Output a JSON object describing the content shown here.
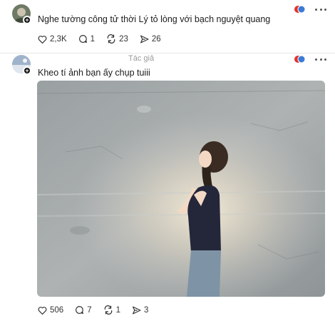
{
  "posts": [
    {
      "text": "Nghe tường công tử thời Lý tỏ lòng với bạch nguyệt quang",
      "likes": "2,3K",
      "comments": "1",
      "reposts": "23",
      "shares": "26"
    },
    {
      "author_tag": "Tác giả",
      "text": "Kheo tí ảnh bạn ấy chụp tuiii",
      "likes": "506",
      "comments": "7",
      "reposts": "1",
      "shares": "3"
    }
  ],
  "icons": {
    "like": "heart-icon",
    "comment": "comment-icon",
    "repost": "repost-icon",
    "share": "share-icon",
    "more": "more-icon",
    "reaction": "reaction-icon"
  },
  "colors": {
    "reaction_red": "#e5312d",
    "reaction_blue": "#3a7bd5",
    "muted_text": "#9a9a9a"
  }
}
